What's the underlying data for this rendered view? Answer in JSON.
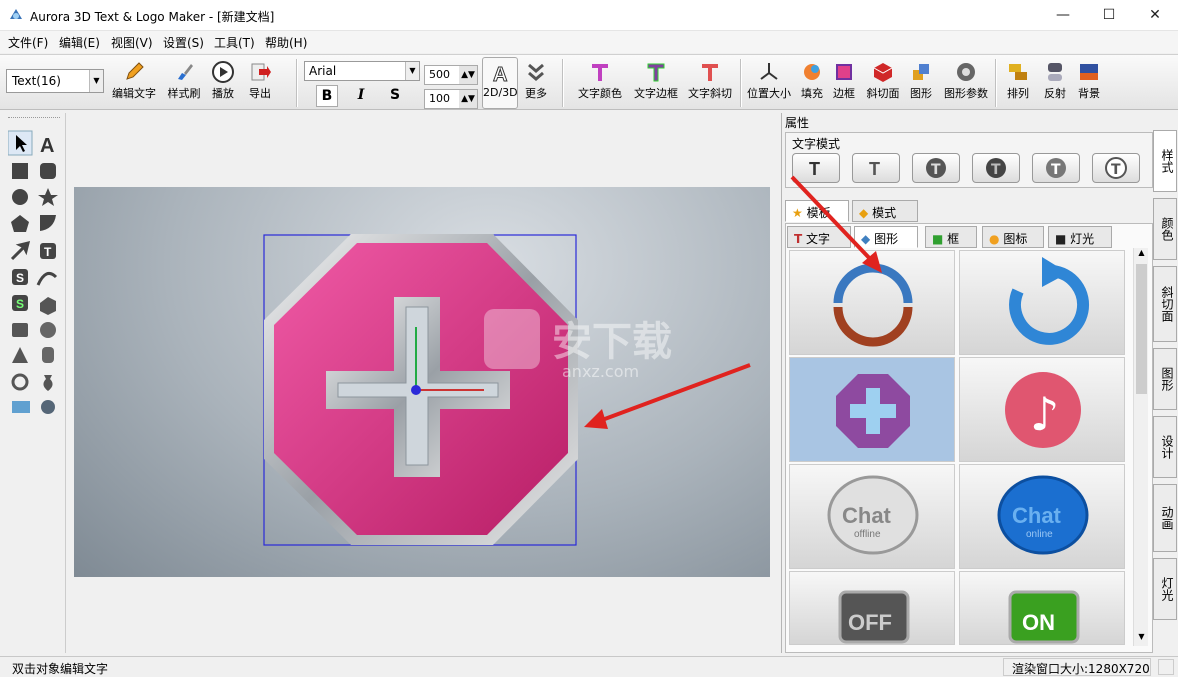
{
  "window": {
    "title": "Aurora 3D Text & Logo Maker - [新建文档]",
    "minimize": "—",
    "maximize": "☐",
    "close": "✕"
  },
  "menu": [
    "文件(F)",
    "编辑(E)",
    "视图(V)",
    "设置(S)",
    "工具(T)",
    "帮助(H)"
  ],
  "toolbar": {
    "object_select": "Text(16)",
    "font": "Arial",
    "size1": "500",
    "size2": "100",
    "bold": "B",
    "italic": "I",
    "shadow": "S",
    "buttons": [
      "编辑文字",
      "样式刷",
      "播放",
      "导出",
      "2D/3D",
      "更多",
      "文字颜色",
      "文字边框",
      "文字斜切",
      "位置大小",
      "填充",
      "边框",
      "斜切面",
      "图形",
      "图形参数",
      "排列",
      "反射",
      "背景"
    ]
  },
  "props": {
    "header": "属性",
    "text_mode": "文字模式",
    "tabs_top": [
      "模板",
      "模式"
    ],
    "tabs_sub": [
      "文字",
      "图形",
      "框",
      "图标",
      "灯光"
    ],
    "thumbs": [
      "",
      "",
      "",
      "",
      "Chat",
      "Chat",
      "OFF",
      "ON"
    ],
    "thumb_sub": [
      "",
      "",
      "",
      "",
      "offline",
      "online",
      "",
      ""
    ]
  },
  "right_tabs": [
    "样式",
    "颜色",
    "斜切面",
    "图形",
    "设计",
    "动画",
    "灯光"
  ],
  "watermark": {
    "text": "安下载",
    "sub": "anxz.com"
  },
  "status": {
    "left": "双击对象编辑文字",
    "right": "渲染窗口大小:1280X720"
  },
  "colors": {
    "shape": "#d63a86",
    "accent": "#2f86d6",
    "arrow": "#e0231f"
  }
}
